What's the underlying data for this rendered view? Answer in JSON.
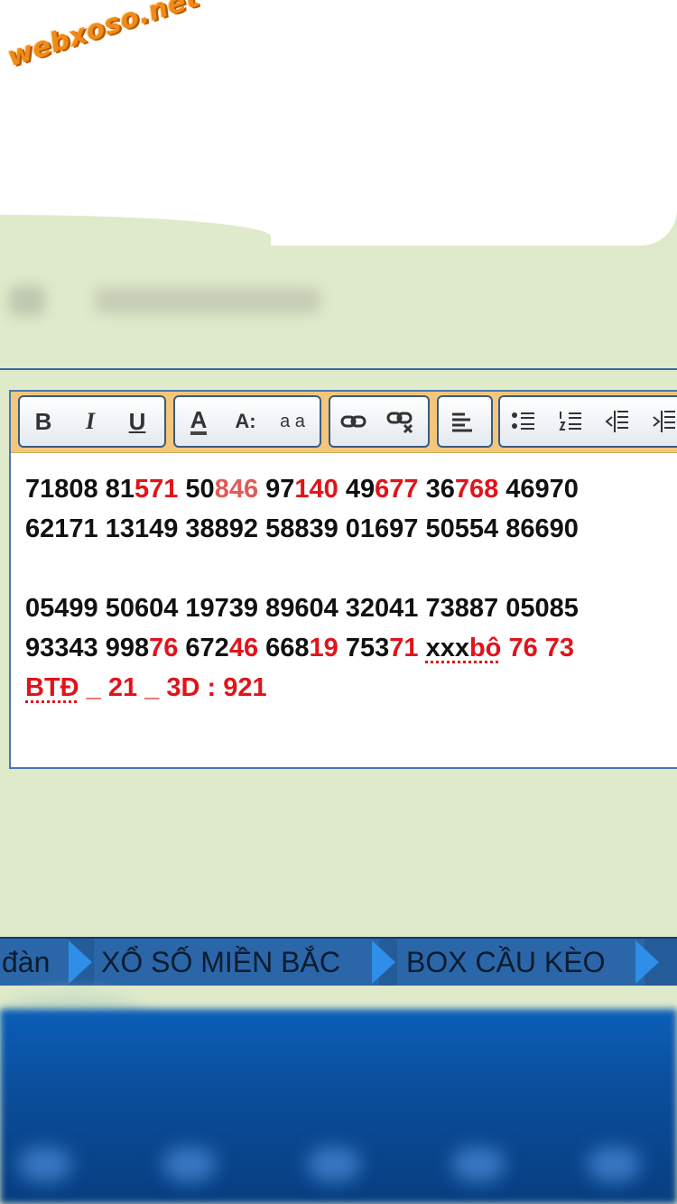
{
  "logo": {
    "text": "webxoso.net"
  },
  "toolbar": {
    "bold": "B",
    "italic": "I",
    "underline": "U",
    "font_color": "A",
    "font_size": "A:",
    "font_family": "a a",
    "icons": [
      "bold-icon",
      "italic-icon",
      "underline-icon",
      "font-color-icon",
      "font-size-icon",
      "font-family-icon",
      "link-icon",
      "unlink-icon",
      "align-left-icon",
      "bullet-list-icon",
      "numbered-list-icon",
      "outdent-icon",
      "indent-icon"
    ]
  },
  "editor": {
    "lines": [
      [
        {
          "t": "71808 81",
          "c": "black"
        },
        {
          "t": "571",
          "c": "red"
        },
        {
          "t": " 50",
          "c": "black"
        },
        {
          "t": "846",
          "c": "pink"
        },
        {
          "t": " 97",
          "c": "black"
        },
        {
          "t": "140",
          "c": "red"
        },
        {
          "t": " 49",
          "c": "black"
        },
        {
          "t": "677",
          "c": "red"
        },
        {
          "t": " 36",
          "c": "black"
        },
        {
          "t": "768",
          "c": "red"
        },
        {
          "t": " 46970",
          "c": "black"
        }
      ],
      [
        {
          "t": "62171 13149 38892 58839 01697 50554 86690",
          "c": "black"
        }
      ],
      [],
      [
        {
          "t": "05499 50604 19739 89604 32041 73887 05085",
          "c": "black"
        }
      ],
      [
        {
          "t": "93343 998",
          "c": "black"
        },
        {
          "t": "76",
          "c": "red"
        },
        {
          "t": " 672",
          "c": "black"
        },
        {
          "t": "46",
          "c": "red"
        },
        {
          "t": " 668",
          "c": "black"
        },
        {
          "t": "19",
          "c": "red"
        },
        {
          "t": " 753",
          "c": "black"
        },
        {
          "t": "71",
          "c": "red"
        },
        {
          "t": " ",
          "c": "black"
        },
        {
          "t": "xxx",
          "c": "black",
          "spell": true
        },
        {
          "t": "bô",
          "c": "red",
          "spell": true
        },
        {
          "t": " 76 73",
          "c": "red"
        }
      ],
      [
        {
          "t": "BTĐ",
          "c": "red",
          "spell": true
        },
        {
          "t": " _ 21 _ 3D : 921",
          "c": "red"
        }
      ]
    ]
  },
  "nav": {
    "items": [
      "đàn",
      "XỔ SỐ MIỀN BẮC",
      "BOX CẦU KÈO"
    ]
  },
  "colors": {
    "background": "#dfeaca",
    "toolbar": "#f2c77c",
    "accent_red": "#e0141a",
    "nav_blue": "#245c9a",
    "nav_arrow": "#2f8ee8"
  }
}
